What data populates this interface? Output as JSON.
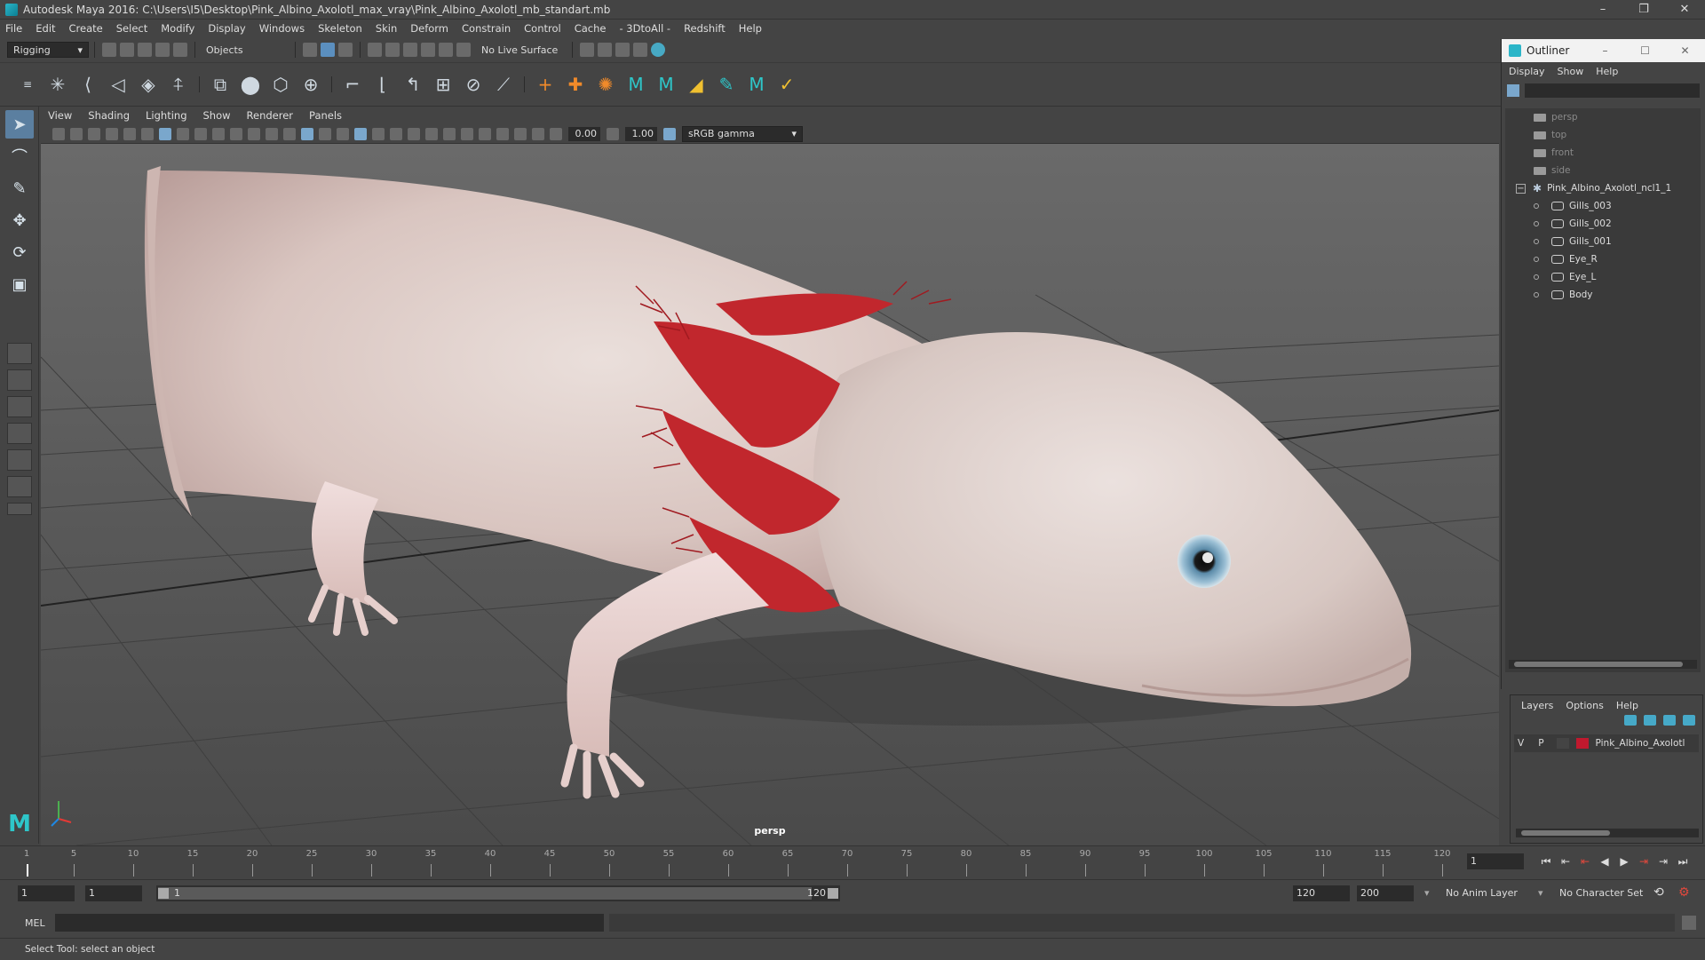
{
  "window": {
    "title": "Autodesk Maya 2016: C:\\Users\\I5\\Desktop\\Pink_Albino_Axolotl_max_vray\\Pink_Albino_Axolotl_mb_standart.mb",
    "minimize": "–",
    "maximize": "❐",
    "close": "✕"
  },
  "menu": [
    "File",
    "Edit",
    "Create",
    "Select",
    "Modify",
    "Display",
    "Windows",
    "Skeleton",
    "Skin",
    "Deform",
    "Constrain",
    "Control",
    "Cache",
    "- 3DtoAll -",
    "Redshift",
    "Help"
  ],
  "status": {
    "mode": "Rigging",
    "selection_mode": "Objects",
    "live_surface": "No Live Surface"
  },
  "viewport": {
    "menu": [
      "View",
      "Shading",
      "Lighting",
      "Show",
      "Renderer",
      "Panels"
    ],
    "exposure": "0.00",
    "gamma": "1.00",
    "color_space": "sRGB gamma",
    "camera_label": "persp"
  },
  "outliner": {
    "title": "Outliner",
    "menu": [
      "Display",
      "Show",
      "Help"
    ],
    "cameras": [
      "persp",
      "top",
      "front",
      "side"
    ],
    "group": "Pink_Albino_Axolotl_ncl1_1",
    "children": [
      "Gills_003",
      "Gills_002",
      "Gills_001",
      "Eye_R",
      "Eye_L",
      "Body"
    ]
  },
  "layers": {
    "menu": [
      "Layers",
      "Options",
      "Help"
    ],
    "layer": {
      "v": "V",
      "p": "P",
      "name": "Pink_Albino_Axolotl",
      "color": "#c0192e"
    }
  },
  "timeline": {
    "ticks": [
      "1",
      "5",
      "10",
      "15",
      "20",
      "25",
      "30",
      "35",
      "40",
      "45",
      "50",
      "55",
      "60",
      "65",
      "70",
      "75",
      "80",
      "85",
      "90",
      "95",
      "100",
      "105",
      "110",
      "115",
      "120"
    ],
    "current_frame": "1"
  },
  "range": {
    "start": "1",
    "playback_start": "1",
    "range_start_label": "1",
    "range_end_label": "120",
    "playback_end": "120",
    "end": "200",
    "anim_layer": "No Anim Layer",
    "character_set": "No Character Set"
  },
  "mel": {
    "label": "MEL"
  },
  "helpline": {
    "text": "Select Tool: select an object"
  }
}
